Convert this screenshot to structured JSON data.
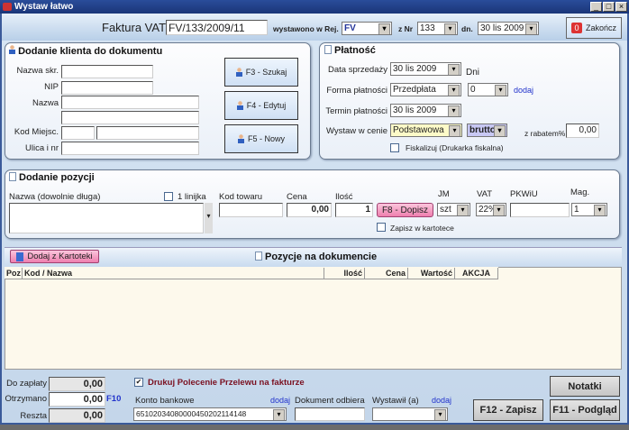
{
  "window": {
    "title": "Wystaw łatwo"
  },
  "header": {
    "doc_type": "Faktura VAT",
    "doc_number": "FV/133/2009/11",
    "reg_label": "wystawono w Rej.",
    "reg_value": "FV",
    "nr_label": "z Nr",
    "nr_value": "133",
    "date_label": "dn.",
    "date_value": "30 lis 2009",
    "close_label": "Zakończ"
  },
  "client": {
    "title": "Dodanie klienta do dokumentu",
    "labels": {
      "short_name": "Nazwa skr.",
      "nip": "NIP",
      "name": "Nazwa",
      "postal": "Kod Miejsc.",
      "street": "Ulica i nr"
    },
    "buttons": {
      "search": "F3 - Szukaj",
      "edit": "F4 - Edytuj",
      "new": "F5 - Nowy"
    }
  },
  "payment": {
    "title": "Płatność",
    "sale_date_label": "Data sprzedaży",
    "sale_date": "30 lis 2009",
    "days_label": "Dni",
    "form_label": "Forma płatności",
    "form_value": "Przedpłata",
    "days_value": "0",
    "add_link": "dodaj",
    "due_label": "Termin płatności",
    "due_date": "30 lis 2009",
    "price_label": "Wystaw w cenie",
    "price_value": "Podstawowa",
    "gross_value": "brutto",
    "discount_label": "z rabatem%",
    "discount_value": "0,00",
    "fiscal_label": "Fiskalizuj (Drukarka fiskalna)",
    "fiscal_checked": false
  },
  "position": {
    "title": "Dodanie pozycji",
    "name_label": "Nazwa  (dowolnie długa)",
    "one_line_label": "1 linijka",
    "code_label": "Kod towaru",
    "price_label": "Cena",
    "price_value": "0,00",
    "qty_label": "Ilość",
    "qty_value": "1",
    "add_button": "F8 - Dopisz",
    "unit_label": "JM",
    "unit_value": "szt",
    "vat_label": "VAT",
    "vat_value": "22%",
    "pkwiu_label": "PKWiU",
    "mag_label": "Mag.",
    "mag_value": "1",
    "save_label": "Zapisz w kartotece"
  },
  "items": {
    "add_button": "Dodaj z Kartoteki",
    "title": "Pozycje na dokumencie",
    "columns": [
      "Poz",
      "Kod / Nazwa",
      "Ilość",
      "Cena",
      "Wartość",
      "AKCJA"
    ],
    "rows": []
  },
  "footer": {
    "to_pay_label": "Do zapłaty",
    "to_pay": "0,00",
    "received_label": "Otrzymano",
    "received": "0,00",
    "received_key": "F10",
    "change_label": "Reszta",
    "change": "0,00",
    "print_transfer_label": "Drukuj Polecenie Przelewu na fakturze",
    "print_transfer_checked": true,
    "account_label": "Konto bankowe",
    "account_add": "dodaj",
    "account_value": "65102034080000450202114148",
    "receiver_label": "Dokument odbiera",
    "issuer_label": "Wystawił (a)",
    "issuer_add": "dodaj",
    "notes_button": "Notatki",
    "save_button": "F12 - Zapisz",
    "preview_button": "F11 - Podgląd"
  }
}
